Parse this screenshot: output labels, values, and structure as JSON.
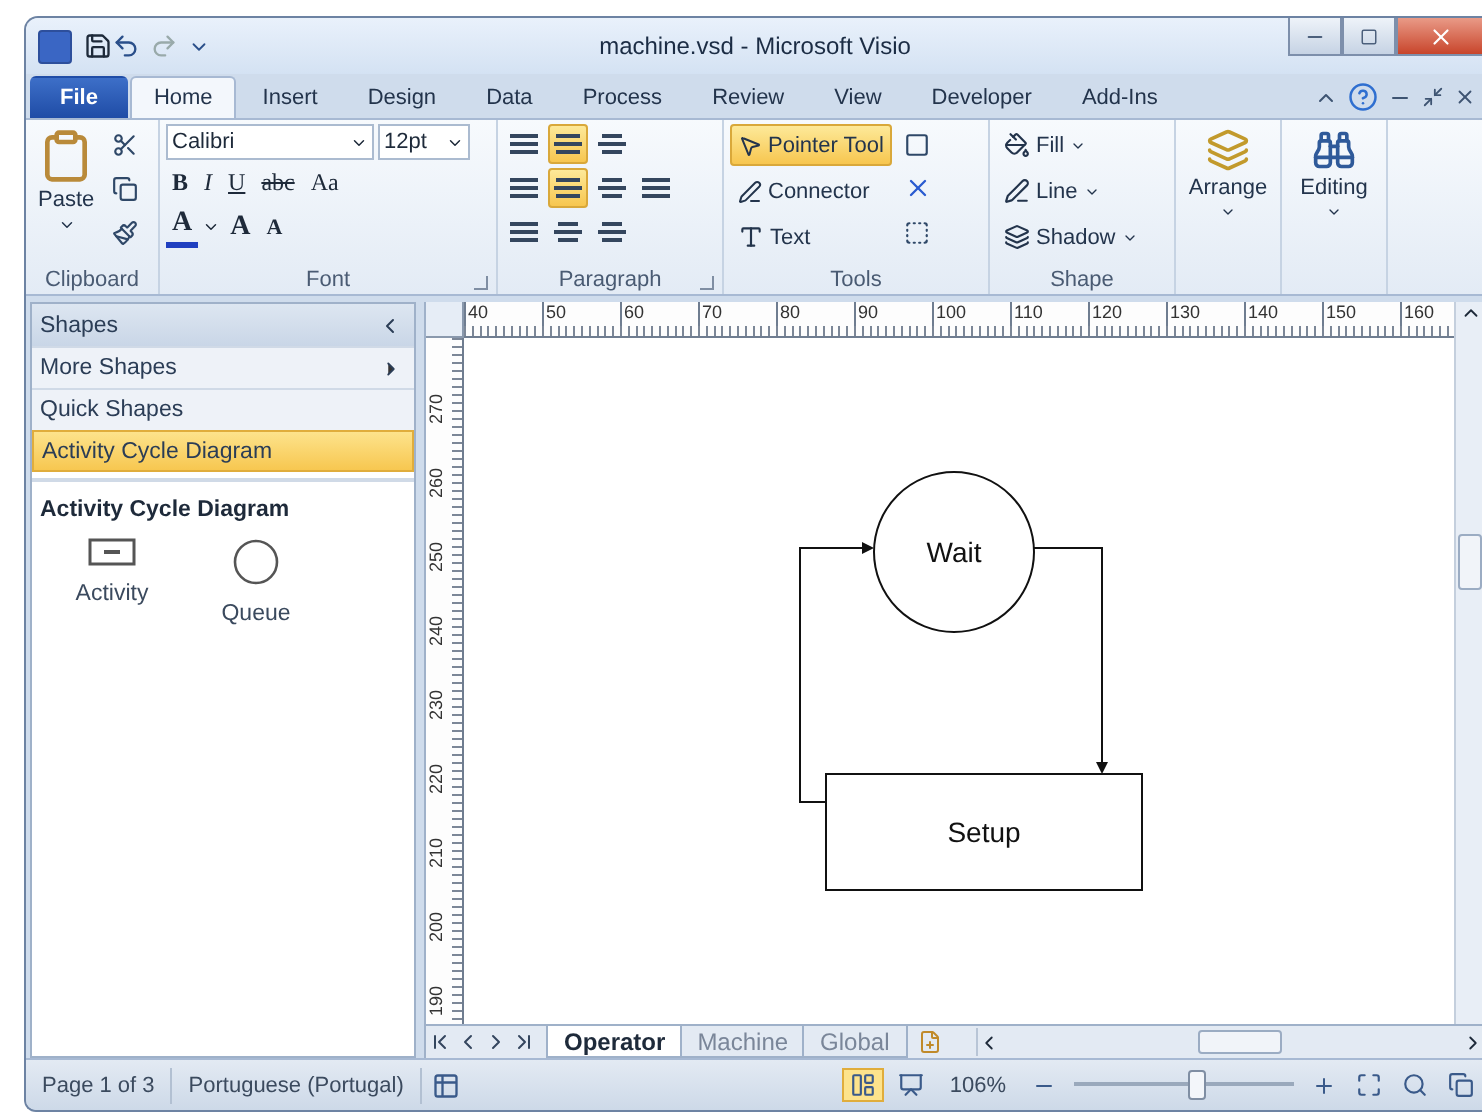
{
  "window": {
    "title": "machine.vsd - Microsoft Visio"
  },
  "ribbon_tabs": [
    {
      "label": "File",
      "kind": "file",
      "selected": false
    },
    {
      "label": "Home",
      "kind": "tab",
      "selected": true
    },
    {
      "label": "Insert",
      "kind": "tab",
      "selected": false
    },
    {
      "label": "Design",
      "kind": "tab",
      "selected": false
    },
    {
      "label": "Data",
      "kind": "tab",
      "selected": false
    },
    {
      "label": "Process",
      "kind": "tab",
      "selected": false
    },
    {
      "label": "Review",
      "kind": "tab",
      "selected": false
    },
    {
      "label": "View",
      "kind": "tab",
      "selected": false
    },
    {
      "label": "Developer",
      "kind": "tab",
      "selected": false
    },
    {
      "label": "Add-Ins",
      "kind": "tab",
      "selected": false
    }
  ],
  "ribbon": {
    "clipboard": {
      "label": "Clipboard",
      "paste": "Paste"
    },
    "font": {
      "label": "Font",
      "font_name": "Calibri",
      "font_size": "12pt",
      "styles": [
        "B",
        "I",
        "U",
        "abc",
        "Aa"
      ],
      "color_glyph": "A",
      "grow": "A",
      "shrink": "A"
    },
    "paragraph": {
      "label": "Paragraph",
      "vertical_align": [
        {
          "selected": false
        },
        {
          "selected": true
        },
        {
          "selected": false
        }
      ],
      "horizontal_align": [
        {
          "selected": false
        },
        {
          "selected": true
        },
        {
          "selected": false
        },
        {
          "selected": false
        }
      ]
    },
    "tools": {
      "label": "Tools",
      "items": [
        {
          "label": "Pointer Tool",
          "kind": "pointer",
          "selected": true
        },
        {
          "label": "Connector",
          "kind": "connector",
          "selected": false
        },
        {
          "label": "Text",
          "kind": "text",
          "selected": false
        }
      ]
    },
    "shape": {
      "label": "Shape",
      "items": [
        "Fill",
        "Line",
        "Shadow"
      ]
    },
    "arrange": {
      "label": "Arrange"
    },
    "editing": {
      "label": "Editing"
    }
  },
  "shapes_panel": {
    "title": "Shapes",
    "items": [
      {
        "label": "More Shapes",
        "kind": "submenu",
        "selected": false
      },
      {
        "label": "Quick Shapes",
        "kind": "plain",
        "selected": false
      },
      {
        "label": "Activity Cycle Diagram",
        "kind": "plain",
        "selected": true
      }
    ],
    "stencil_title": "Activity Cycle Diagram",
    "masters": [
      {
        "label": "Activity",
        "kind": "activity"
      },
      {
        "label": "Queue",
        "kind": "queue"
      }
    ]
  },
  "rulers": {
    "horizontal": [
      "40",
      "50",
      "60",
      "70",
      "80",
      "90",
      "100",
      "110",
      "120",
      "130",
      "140",
      "150",
      "160"
    ],
    "vertical": [
      "270",
      "260",
      "250",
      "240",
      "230",
      "220",
      "210",
      "200",
      "190"
    ]
  },
  "diagram": {
    "nodes": [
      {
        "kind": "circle",
        "label": "Wait"
      },
      {
        "kind": "rect",
        "label": "Setup"
      }
    ]
  },
  "page_tabs": [
    {
      "label": "Operator",
      "selected": true
    },
    {
      "label": "Machine",
      "selected": false
    },
    {
      "label": "Global",
      "selected": false
    }
  ],
  "status_bar": {
    "page": "Page 1 of 3",
    "language": "Portuguese (Portugal)",
    "zoom": "106%",
    "zoom_slider": {
      "level": 0.55
    }
  }
}
